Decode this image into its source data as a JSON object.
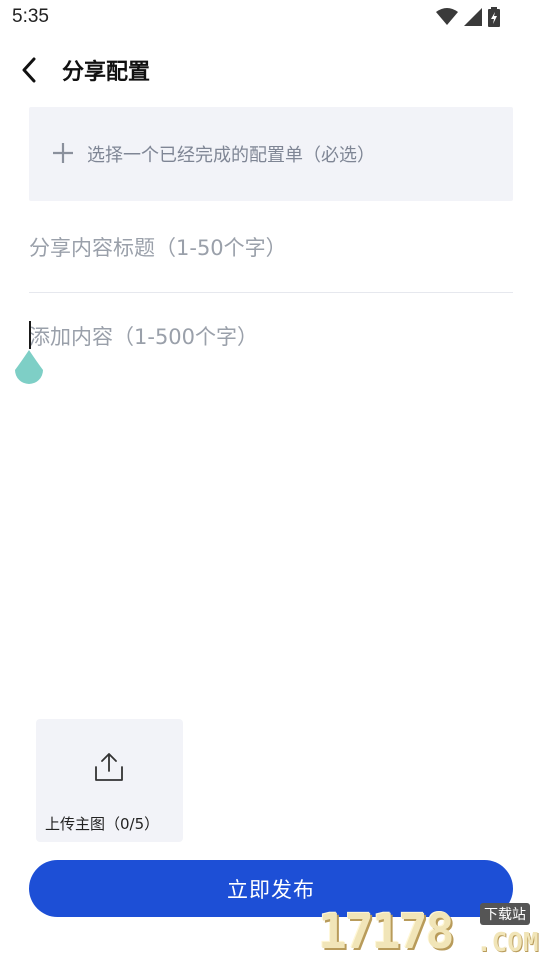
{
  "status_bar": {
    "time": "5:35"
  },
  "header": {
    "title": "分享配置"
  },
  "form": {
    "select_config_label": "选择一个已经完成的配置单（必选）",
    "title_placeholder": "分享内容标题（1-50个字）",
    "content_placeholder": "添加内容（1-500个字）",
    "upload_label": "上传主图（0/5）"
  },
  "actions": {
    "publish_label": "立即发布"
  },
  "watermark": {
    "number": "17178",
    "domain": ".COM",
    "tag": "下载站"
  },
  "colors": {
    "accent": "#1d4fd6",
    "field_bg": "#f2f3f8",
    "cursor_handle": "#7ecfc6"
  }
}
